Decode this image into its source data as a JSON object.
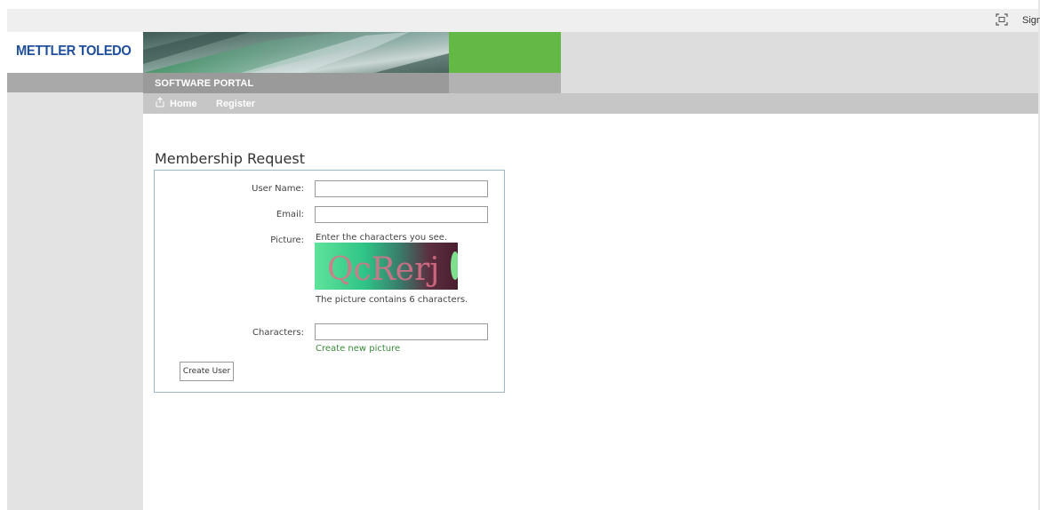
{
  "topbar": {
    "fullscreen_icon": "fullscreen-icon",
    "sign_in_label": "Sign In"
  },
  "brand": {
    "logo_text": "METTLER TOLEDO",
    "portal_title": "SOFTWARE PORTAL",
    "colors": {
      "logo_blue": "#1f4f9c",
      "banner_green": "#64b946"
    }
  },
  "nav": {
    "home_icon": "home-icon",
    "home_label": "Home",
    "register_label": "Register"
  },
  "page": {
    "heading": "Membership Request"
  },
  "form": {
    "username_label": "User Name:",
    "username_value": "",
    "email_label": "Email:",
    "email_value": "",
    "picture_label": "Picture:",
    "picture_hint": "Enter the characters you see.",
    "captcha_text": "QcRerj",
    "picture_count": "The picture contains 6 characters.",
    "characters_label": "Characters:",
    "characters_value": "",
    "new_picture_link": "Create new picture",
    "link_color": "#3b8a3b",
    "submit_label": "Create User"
  }
}
